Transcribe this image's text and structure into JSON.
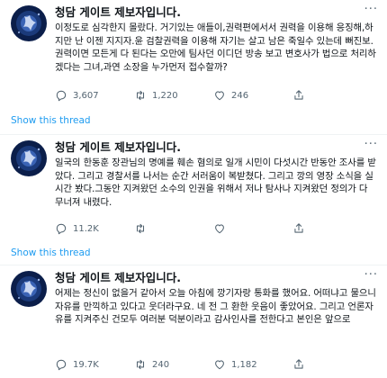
{
  "tweets": [
    {
      "name": "청담 게이트 제보자입니다.",
      "more_icon": "···",
      "text": "이정도로 심각한지 몰랐다. 거기있는 애들이,권력편에서서 권력을 이용해 응징해,하지만 난 이젠 지지자.윤 검찰권력을 이용해 자기는 살고 남은 죽일수 있는데 뻐진보. 권력이면 모든게 다 된다는 오만에 팀사던 이디던 방송 보고 변호사가 법으로 처리하겠다는 그녀,과연 소장을 누가먼저 접수할까?",
      "replies": "3,607",
      "retweets": "1,220",
      "likes": "246",
      "show_thread": "Show this thread"
    },
    {
      "name": "청담 게이트 제보자입니다.",
      "more_icon": "···",
      "text": "일국의 한동훈 장관님의 명예를 훼손 혐의로 일개 시민이 다섯시간 반동안 조사를 받았다. 그리고 경찰서를 나서는 순간 서러움이 복받쳤다. 그리고 깡의 영장 소식을 실시간 봤다.그동안 지켜왔던 소수의 인권을 위해서 저나 탐사나 지켜왔던 정의가 다 무너져 내렸다.",
      "replies": "11.2K",
      "retweets": "",
      "likes": "",
      "show_thread": "Show this thread"
    },
    {
      "name": "청담 게이트 제보자입니다.",
      "more_icon": "···",
      "text": "어제는 정신이 없을거 같아서 오늘 아침에 깡기자랑 통화를 했어요. 어떠냐고 물으니 자유를 만끽하고 있다고 웃더라구요. 네 전 그 환한 웃음이 좋았어요. 그리고 언론자유를 지켜주신 건모두 여러분 덕분이라고 감사인사를 전한다고 본인은 앞으로",
      "replies": "19.7K",
      "retweets": "240",
      "likes": "1,182",
      "show_thread": ""
    }
  ],
  "colors": {
    "accent": "#1d9bf0",
    "muted": "#536471",
    "divider": "#eff3f4"
  },
  "icons": {
    "reply": "reply-icon",
    "retweet": "retweet-icon",
    "like": "heart-icon",
    "share": "share-icon",
    "more": "more-icon"
  }
}
